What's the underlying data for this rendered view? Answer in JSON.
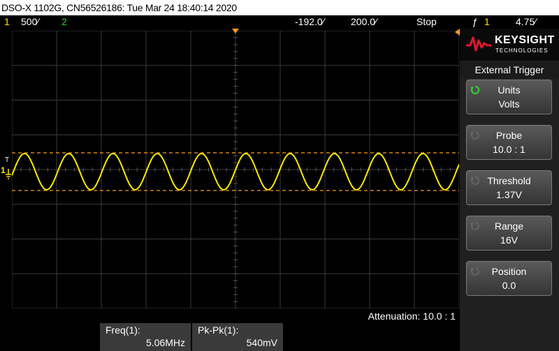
{
  "title": "DSO-X 1102G, CN56526186: Tue Mar 24 18:40:14 2020",
  "status": {
    "channel1_number": "1",
    "channel1_scale": "500∕",
    "channel2_number": "2",
    "delay": "-192.0∕",
    "timebase": "200.0∕",
    "run_state": "Stop",
    "trigger_symbol": "ƒ",
    "trigger_channel": "1",
    "trigger_level": "4.75∕"
  },
  "markers": {
    "trigger_marker": "T",
    "channel_marker": "1"
  },
  "attenuation": "Attenuation: 10.0 : 1",
  "measurements": [
    {
      "label": "Freq(1):",
      "value": "5.06MHz"
    },
    {
      "label": "Pk-Pk(1):",
      "value": "540mV"
    }
  ],
  "logo": {
    "brand": "KEYSIGHT",
    "sub": "TECHNOLOGIES"
  },
  "panel": {
    "title": "External Trigger",
    "softkeys": [
      {
        "label": "Units",
        "value": "Volts"
      },
      {
        "label": "Probe",
        "value": "10.0 : 1"
      },
      {
        "label": "Threshold",
        "value": "1.37V"
      },
      {
        "label": "Range",
        "value": "16V"
      },
      {
        "label": "Position",
        "value": "0.0"
      }
    ]
  },
  "colors": {
    "trace": "#ffea00",
    "cursor": "#ff9a1a",
    "grid": "#3c3c3c",
    "accent_green": "#33cc33"
  },
  "chart_data": {
    "type": "line",
    "trace": "channel 1 sine wave",
    "frequency_mhz": 5.06,
    "peak_to_peak_mv": 540,
    "cycles_shown": 10.1
  }
}
